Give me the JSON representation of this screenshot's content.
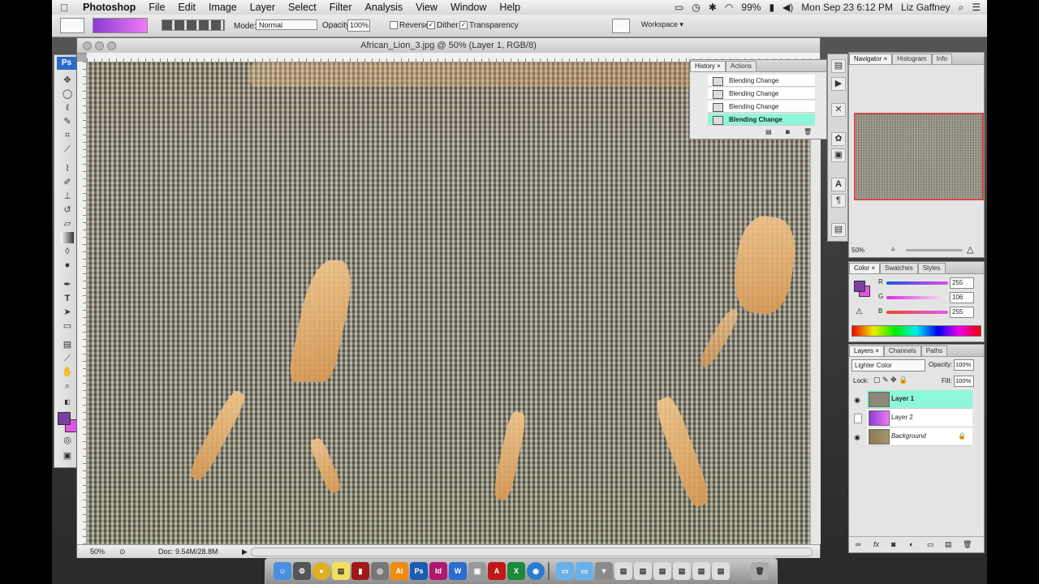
{
  "menubar": {
    "apple": "",
    "items": [
      "Photoshop",
      "File",
      "Edit",
      "Image",
      "Layer",
      "Select",
      "Filter",
      "Analysis",
      "View",
      "Window",
      "Help"
    ],
    "battery": "99%",
    "datetime": "Mon Sep 23  6:12 PM",
    "user": "Liz Gaffney"
  },
  "options": {
    "mode_label": "Mode:",
    "mode_value": "Normal",
    "opacity_label": "Opacity:",
    "opacity_value": "100%",
    "reverse": "Reverse",
    "dither": "Dither",
    "transparency": "Transparency",
    "workspace": "Workspace ▾"
  },
  "toolbox": {
    "logo": "Ps"
  },
  "document": {
    "title": "African_Lion_3.jpg @ 50% (Layer 1, RGB/8)",
    "zoom": "50%",
    "doc_info": "Doc: 9.54M/28.8M"
  },
  "history": {
    "tabs": [
      "History ×",
      "Actions"
    ],
    "items": [
      "Blending Change",
      "Blending Change",
      "Blending Change",
      "Blending Change"
    ]
  },
  "navigator": {
    "tabs": [
      "Navigator ×",
      "Histogram",
      "Info"
    ],
    "zoom": "50%"
  },
  "color": {
    "tabs": [
      "Color ×",
      "Swatches",
      "Styles"
    ],
    "r_label": "R",
    "g_label": "G",
    "b_label": "B",
    "r": "255",
    "g": "106",
    "b": "255"
  },
  "layers": {
    "tabs": [
      "Layers ×",
      "Channels",
      "Paths"
    ],
    "blend_mode": "Lighter Color",
    "opacity_label": "Opacity:",
    "opacity": "100%",
    "lock_label": "Lock:",
    "fill_label": "Fill:",
    "fill": "100%",
    "items": [
      "Layer 1",
      "Layer 2",
      "Background"
    ]
  },
  "colors": {
    "foreground": "#7a3fa0",
    "background": "#e055e8",
    "selection": "#8ff7d9"
  }
}
